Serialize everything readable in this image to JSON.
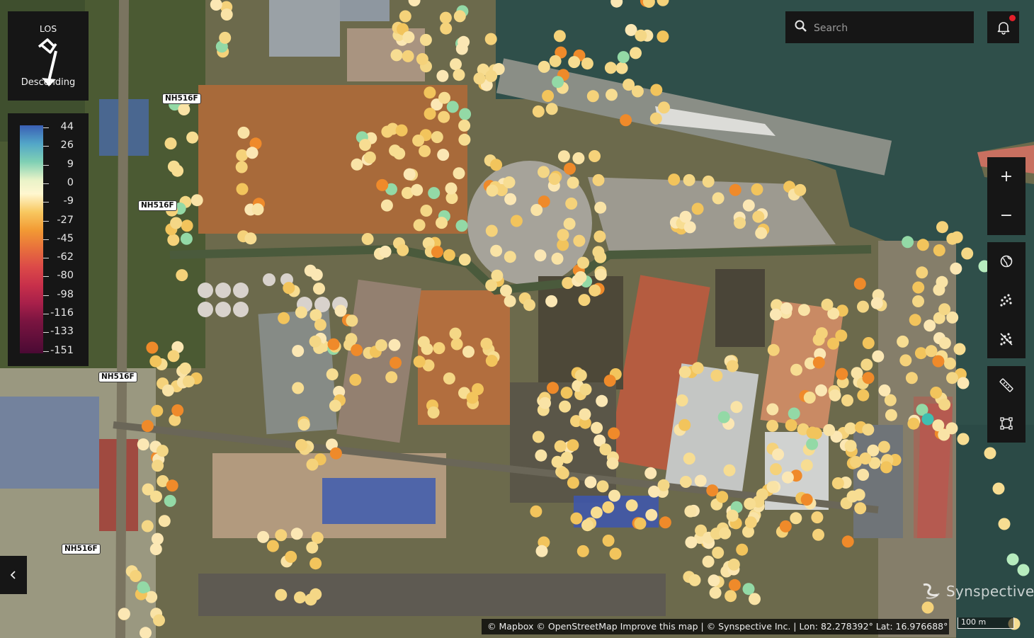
{
  "los": {
    "title": "LOS",
    "direction": "Descending"
  },
  "legend": {
    "values": [
      "44",
      "26",
      "9",
      "0",
      "-9",
      "-27",
      "-45",
      "-62",
      "-80",
      "-98",
      "-116",
      "-133",
      "-151"
    ]
  },
  "search": {
    "placeholder": "Search"
  },
  "icons": {
    "search": "search-icon",
    "bell": "bell-icon",
    "zoom_in": "plus-icon",
    "zoom_out": "minus-icon",
    "globe": "globe-icon",
    "cluster": "points-cluster-icon",
    "cluster_off": "points-cluster-off-icon",
    "ruler": "ruler-icon",
    "area": "area-select-icon",
    "collapse": "chevron-left-icon"
  },
  "toolbar": {
    "zoom_in": "+",
    "zoom_out": "−"
  },
  "road_labels": [
    "NH516F",
    "NH516F",
    "NH516F",
    "NH516F"
  ],
  "attribution": "© Mapbox © OpenStreetMap Improve this map  | © Synspective Inc. | Lon: 82.278392° Lat: 16.976688°",
  "scale": "100 m",
  "watermark": "Synspective",
  "colors": {
    "panel": "#161616",
    "notification": "#e4202a",
    "point_main": "#f5d27a",
    "point_orange": "#ef8a2a",
    "point_green": "#8ed9a0"
  }
}
